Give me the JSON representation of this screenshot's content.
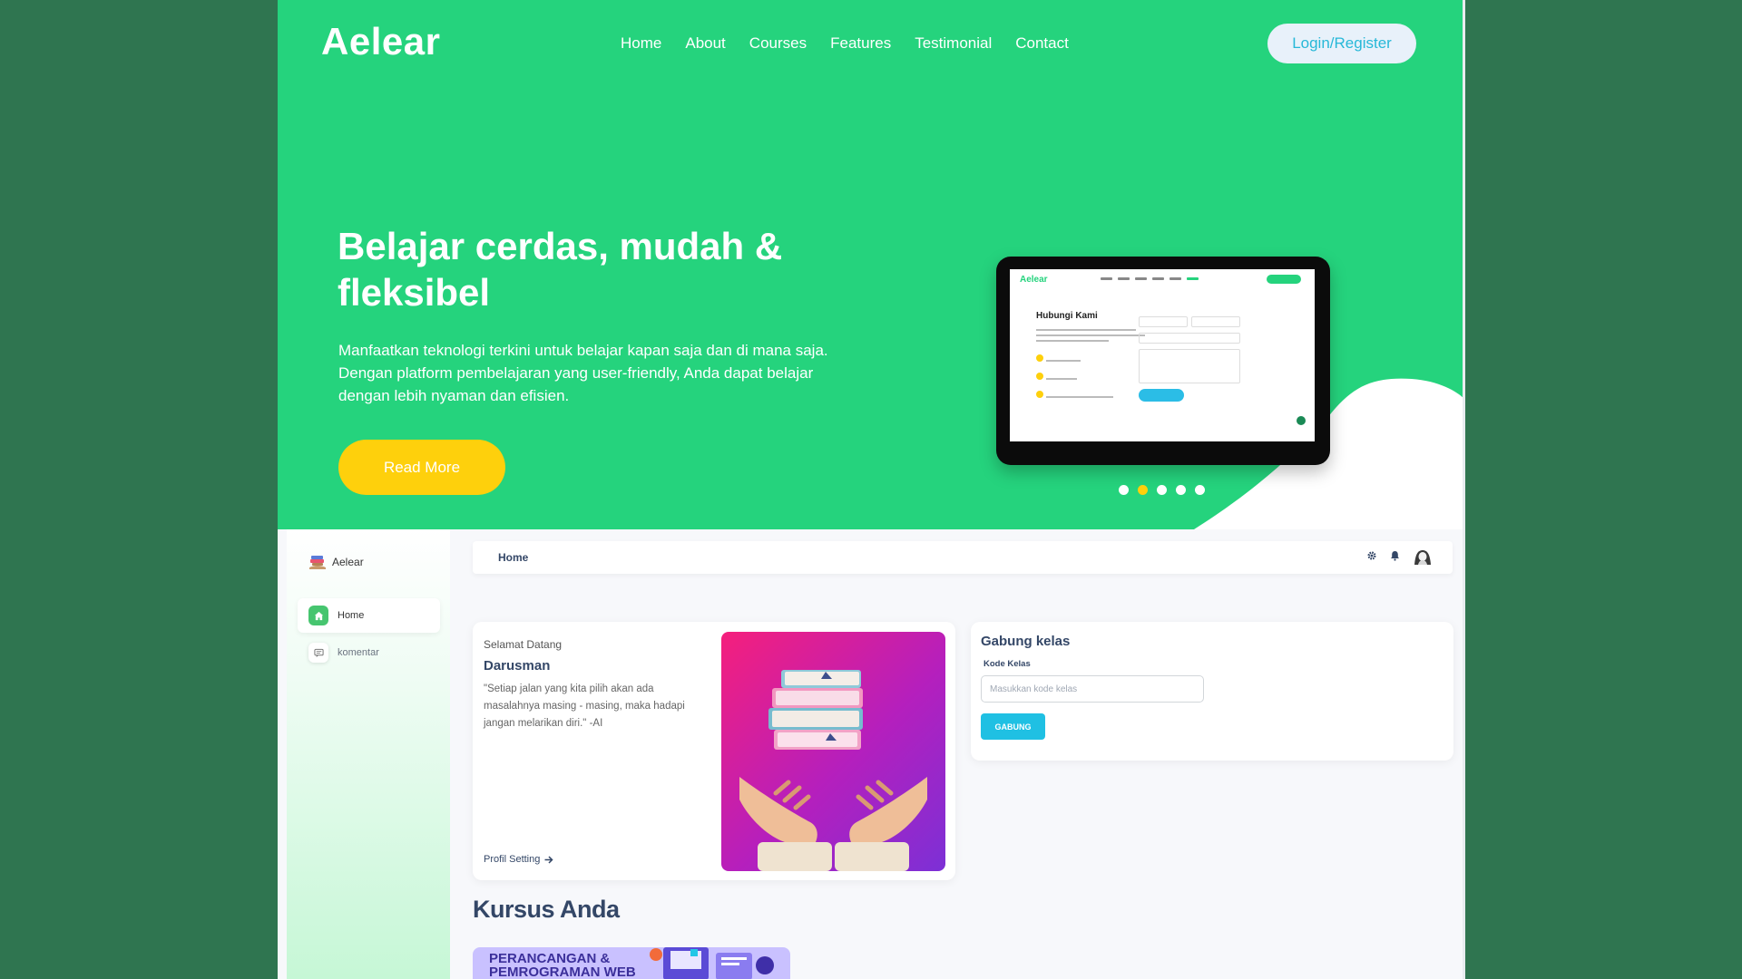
{
  "hero": {
    "logo": "Aelear",
    "nav": [
      "Home",
      "About",
      "Courses",
      "Features",
      "Testimonial",
      "Contact"
    ],
    "login_label": "Login/Register",
    "title": "Belajar cerdas, mudah & fleksibel",
    "description": "Manfaatkan teknologi terkini untuk belajar kapan saja dan di mana saja. Dengan platform pembelajaran yang user-friendly, Anda dapat belajar dengan lebih nyaman dan efisien.",
    "read_more_label": "Read More",
    "tablet_preview": {
      "logo": "Aelear",
      "title": "Hubungi Kami"
    },
    "carousel": {
      "count": 5,
      "active_index": 1
    }
  },
  "colors": {
    "hero_green": "#25d37d",
    "accent_yellow": "#fed00c",
    "button_cyan": "#1fc0e3",
    "text_dark": "#344767",
    "backdrop": "#2f7550"
  },
  "sidebar": {
    "brand": "Aelear",
    "items": [
      {
        "label": "Home",
        "icon": "home-icon",
        "active": true
      },
      {
        "label": "komentar",
        "icon": "comment-icon",
        "active": false
      }
    ]
  },
  "topbar": {
    "title": "Home",
    "icons": [
      "gear-icon",
      "bell-icon",
      "avatar"
    ]
  },
  "welcome": {
    "greeting": "Selamat Datang",
    "name": "Darusman",
    "quote": "\"Setiap jalan yang kita pilih akan ada masalahnya masing - masing, maka hadapi jangan melarikan diri.\" -AI",
    "link_label": "Profil Setting",
    "image": "books-hands-illustration"
  },
  "join_class": {
    "title": "Gabung kelas",
    "field_label": "Kode Kelas",
    "placeholder": "Masukkan kode kelas",
    "button_label": "GABUNG"
  },
  "courses": {
    "title": "Kursus Anda",
    "items": [
      {
        "title_line1": "PERANCANGAN &",
        "title_line2": "PEMROGRAMAN WEB"
      }
    ]
  }
}
